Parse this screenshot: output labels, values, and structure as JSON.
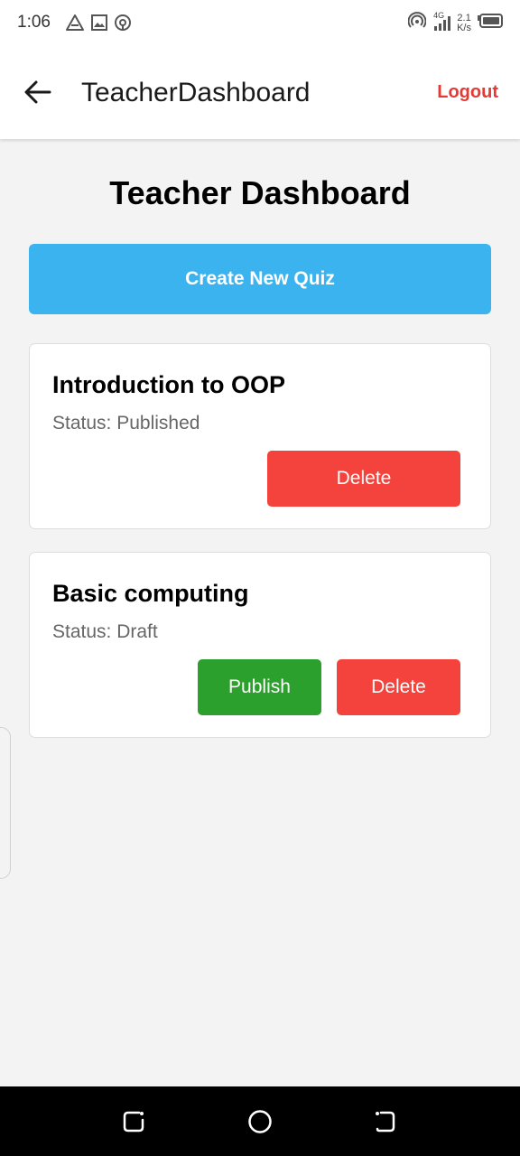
{
  "status_bar": {
    "time": "1:06",
    "network_type": "4G",
    "speed_value": "2.1",
    "speed_unit": "K/s",
    "icons": [
      "warning-icon",
      "image-icon",
      "sync-icon",
      "hotspot-icon",
      "signal-icon",
      "battery-icon"
    ]
  },
  "app_bar": {
    "title": "TeacherDashboard",
    "logout_label": "Logout",
    "back_icon": "arrow-left-icon"
  },
  "main": {
    "heading": "Teacher Dashboard",
    "create_button_label": "Create New Quiz",
    "quizzes": [
      {
        "title": "Introduction to OOP",
        "status": "Status: Published",
        "delete_label": "Delete"
      },
      {
        "title": "Basic computing",
        "status": "Status: Draft",
        "publish_label": "Publish",
        "delete_label": "Delete"
      }
    ]
  },
  "nav_bar": {
    "icons": [
      "recent-apps-icon",
      "home-icon",
      "back-nav-icon"
    ]
  },
  "colors": {
    "accent_blue": "#3bb3ef",
    "delete_red": "#f4433c",
    "publish_green": "#2ca02c",
    "logout_red": "#e53935",
    "background": "#f3f3f3"
  }
}
